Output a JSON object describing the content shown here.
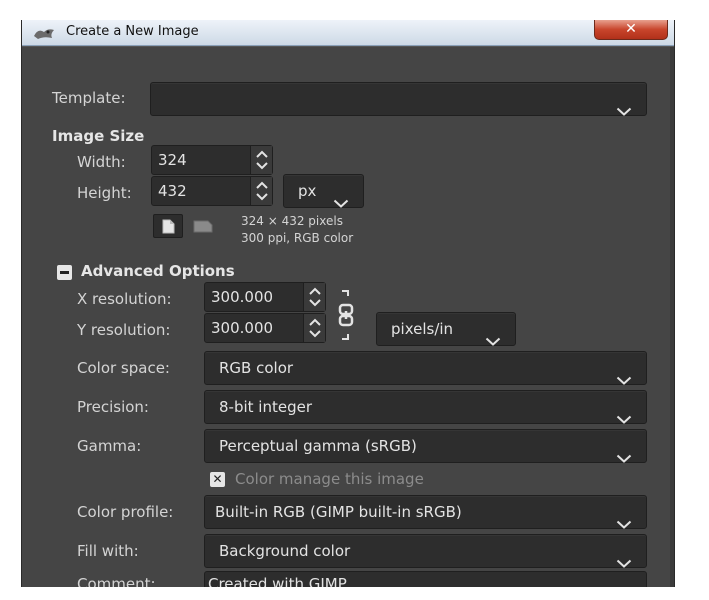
{
  "window": {
    "title": "Create a New Image",
    "close_glyph": "✕"
  },
  "template": {
    "label": "Template:",
    "value": ""
  },
  "image_size": {
    "heading": "Image Size",
    "width_label": "Width:",
    "width_value": "324",
    "height_label": "Height:",
    "height_value": "432",
    "unit": "px",
    "info_line1": "324 × 432 pixels",
    "info_line2": "300 ppi, RGB color"
  },
  "advanced": {
    "heading": "Advanced Options",
    "xres_label": "X resolution:",
    "xres_value": "300.000",
    "yres_label": "Y resolution:",
    "yres_value": "300.000",
    "res_unit": "pixels/in",
    "colorspace_label": "Color space:",
    "colorspace_value": "RGB color",
    "precision_label": "Precision:",
    "precision_value": "8-bit integer",
    "gamma_label": "Gamma:",
    "gamma_value": "Perceptual gamma (sRGB)",
    "manage_label": "Color manage this image",
    "profile_label": "Color profile:",
    "profile_value": "Built-in RGB (GIMP built-in sRGB)",
    "fill_label": "Fill with:",
    "fill_value": "Background color",
    "comment_label": "Comment:",
    "comment_value": "Created with GIMP"
  },
  "icons": {
    "app": "gimp-wilber-icon",
    "chevron": "chevron-down-icon",
    "spin": "spin-arrows-icon",
    "portrait": "portrait-orientation-icon",
    "landscape": "landscape-orientation-icon",
    "chain": "chain-link-icon",
    "check": "checkmark-icon",
    "collapse": "collapse-minus-icon"
  },
  "colors": {
    "background": "#454545",
    "field": "#2d2d2d",
    "text": "#d4d4d4",
    "close": "#c8452c"
  }
}
